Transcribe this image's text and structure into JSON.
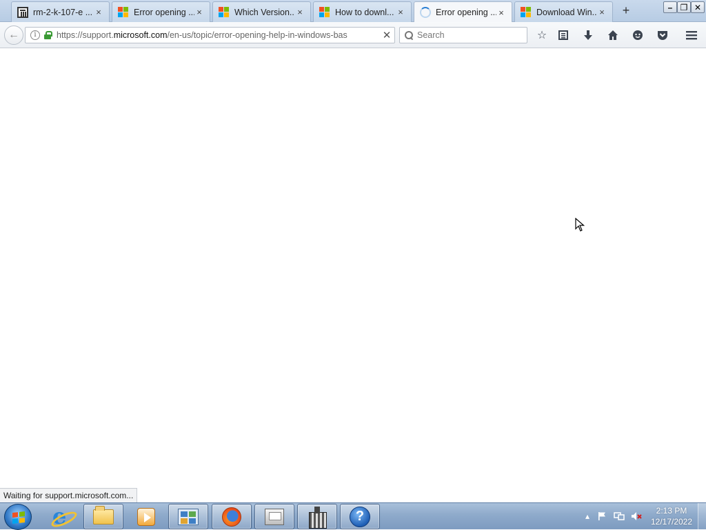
{
  "browser": {
    "tabs": [
      {
        "title": "rm-2-k-107-e ...",
        "favicon": "archive-icon",
        "close": "×"
      },
      {
        "title": "Error opening ...",
        "favicon": "microsoft-logo-icon",
        "close": "×"
      },
      {
        "title": "Which Version...",
        "favicon": "microsoft-logo-icon",
        "close": "×"
      },
      {
        "title": "How to downl...",
        "favicon": "microsoft-logo-icon",
        "close": "×"
      },
      {
        "title": "Error opening ...",
        "favicon": "loading-spinner-icon",
        "close": "×",
        "active": true
      },
      {
        "title": "Download Win...",
        "favicon": "microsoft-logo-icon",
        "close": "×"
      }
    ],
    "new_tab": "+",
    "window_controls": {
      "minimize": "–",
      "restore": "❐",
      "close": "✕"
    },
    "url": {
      "prefix": "https://support.",
      "domain": "microsoft.com",
      "path": "/en-us/topic/error-opening-help-in-windows-bas"
    },
    "stop": "✕",
    "search_placeholder": "Search",
    "toolbar_icons": [
      "bookmark-star-icon",
      "reading-list-icon",
      "download-icon",
      "home-icon",
      "chat-icon",
      "pocket-icon",
      "menu-icon"
    ],
    "status_text": "Waiting for support.microsoft.com..."
  },
  "taskbar": {
    "pinned": [
      "internet-explorer-icon",
      "file-explorer-icon",
      "media-player-icon",
      "control-panel-icon",
      "firefox-icon",
      "print-scan-icon",
      "castle-app-icon",
      "help-icon"
    ],
    "help_glyph": "?",
    "clock": {
      "time": "2:13 PM",
      "date": "12/17/2022"
    }
  },
  "colors": {
    "accent": "#2a7fd4",
    "lock_green": "#3a9a34",
    "taskbar": "#8eaacb"
  }
}
